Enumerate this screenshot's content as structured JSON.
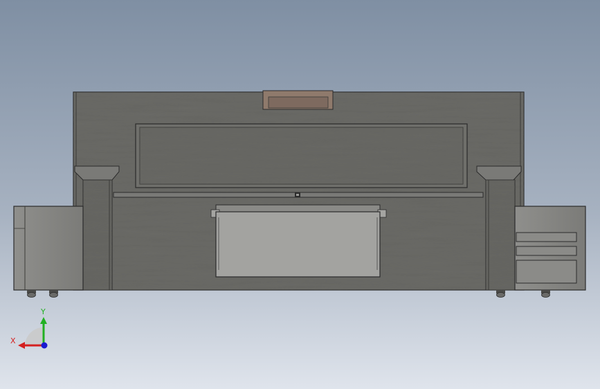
{
  "viewport": {
    "background_top": "#7f8fa3",
    "background_bottom": "#dfe4ec"
  },
  "model": {
    "body_color": "#6a6a66",
    "panel_color": "#9b9b98",
    "outline_color": "#2b2b2b",
    "accent_color": "#8f7a6c"
  },
  "triad": {
    "x_label": "X",
    "y_label": "Y",
    "x_color": "#d42020",
    "y_color": "#22b022",
    "z_color": "#1a1ad0"
  }
}
